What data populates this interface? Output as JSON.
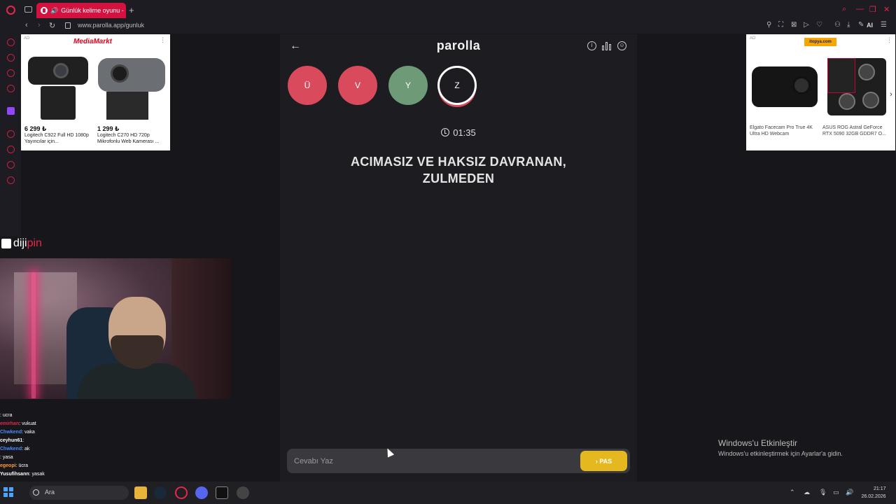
{
  "browser": {
    "tab_title": "Günlük kelime oyunu -",
    "url": "www.parolla.app/gunluk",
    "ai_label": "AI"
  },
  "ads": {
    "left": {
      "label": "AD",
      "brand": "MediaMarkt",
      "products": [
        {
          "price": "6 299 ₺",
          "name": "Logitech C922 Full HD 1080p Yayıncılar için..."
        },
        {
          "price": "1 299 ₺",
          "name": "Logitech C270 HD 720p Mikrofonlu Web Kamerası ..."
        }
      ]
    },
    "right": {
      "label": "AD",
      "brand": "itopya.com",
      "products": [
        {
          "name": "Elgato Facecam Pro True 4K Ultra HD Webcam"
        },
        {
          "name": "ASUS ROG Astral GeForce RTX 5090 32GB GDDR7 O..."
        }
      ]
    }
  },
  "stream": {
    "brand_prefix": "diji",
    "brand_suffix": "pin",
    "chat": [
      {
        "user": "",
        "text": ": ucra",
        "color": "#e8264a"
      },
      {
        "user": "emirhan",
        "text": ": vukuat",
        "color": "#e8264a"
      },
      {
        "user": "Chwkend",
        "text": ": vaka",
        "color": "#4a8aff"
      },
      {
        "user": "ceyhun61",
        "text": ":",
        "color": "#ffffff"
      },
      {
        "user": "Chwkend",
        "text": ": ak",
        "color": "#4a8aff"
      },
      {
        "user": "",
        "text": ": yasa",
        "color": "#e8264a"
      },
      {
        "user": "egeopi",
        "text": ": ücra",
        "color": "#ff9a3a"
      },
      {
        "user": "Yusufihsann",
        "text": ": yasak",
        "color": "#ffffff"
      }
    ]
  },
  "game": {
    "logo": "parolla",
    "letters": [
      {
        "char": "Ü",
        "state": "red"
      },
      {
        "char": "V",
        "state": "red"
      },
      {
        "char": "Y",
        "state": "green"
      },
      {
        "char": "Z",
        "state": "active"
      }
    ],
    "timer": "01:35",
    "question_line1": "ACIMASIZ VE HAKSIZ DAVRANAN,",
    "question_line2": "ZULMEDEN",
    "answer_placeholder": "Cevabı Yaz",
    "pass_label": "PAS"
  },
  "windows_activation": {
    "title": "Windows'u Etkinleştir",
    "subtitle": "Windows'u etkinleştirmek için Ayarlar'a gidin."
  },
  "taskbar": {
    "search_placeholder": "Ara",
    "time": "21:17",
    "date": "26.02.2026"
  },
  "colors": {
    "accent_red": "#d84a5c",
    "correct_green": "#6f9a78",
    "pass_yellow": "#e6b820",
    "opera_red": "#d3123f"
  }
}
